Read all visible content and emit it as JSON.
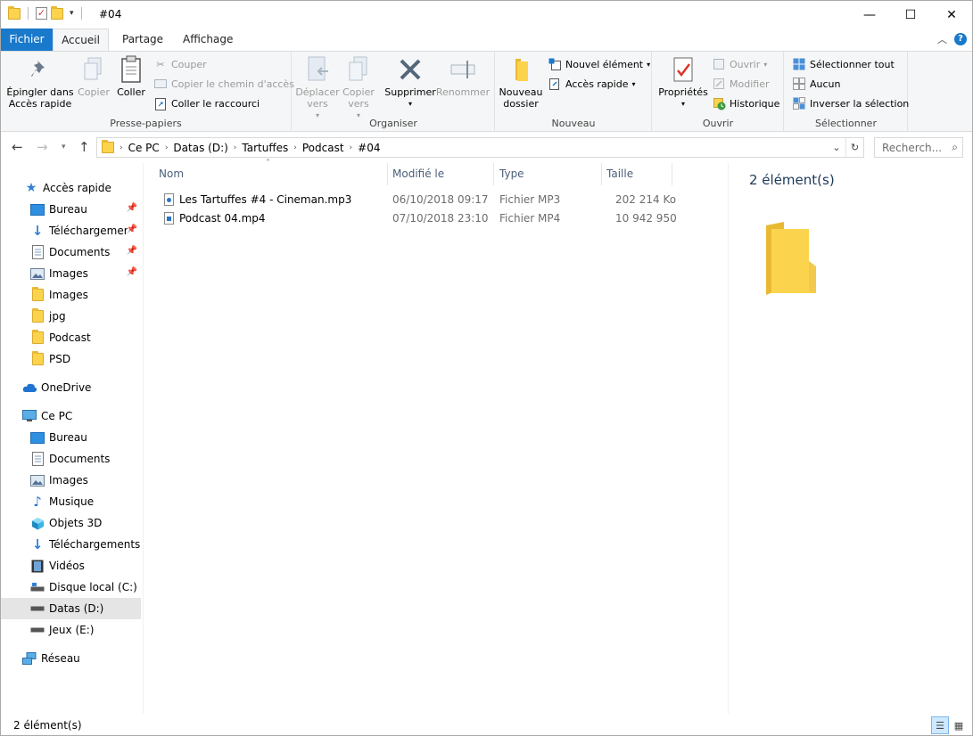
{
  "window": {
    "title": "#04",
    "minimize_glyph": "—",
    "maximize_glyph": "☐",
    "close_glyph": "✕"
  },
  "tabs": {
    "file": "Fichier",
    "home": "Accueil",
    "share": "Partage",
    "view": "Affichage"
  },
  "ribbon": {
    "clipboard": {
      "label": "Presse-papiers",
      "pin": "Épingler dans Accès rapide",
      "copy": "Copier",
      "paste": "Coller",
      "cut": "Couper",
      "copy_path": "Copier le chemin d'accès",
      "paste_shortcut": "Coller le raccourci"
    },
    "organize": {
      "label": "Organiser",
      "move_to": "Déplacer vers",
      "copy_to": "Copier vers",
      "delete": "Supprimer",
      "rename": "Renommer"
    },
    "new": {
      "label": "Nouveau",
      "new_folder": "Nouveau dossier",
      "new_item": "Nouvel élément",
      "easy_access": "Accès rapide"
    },
    "open": {
      "label": "Ouvrir",
      "properties": "Propriétés",
      "open": "Ouvrir",
      "edit": "Modifier",
      "history": "Historique"
    },
    "select": {
      "label": "Sélectionner",
      "select_all": "Sélectionner tout",
      "select_none": "Aucun",
      "invert": "Inverser la sélection"
    }
  },
  "address": {
    "crumbs": [
      "Ce PC",
      "Datas (D:)",
      "Tartuffes",
      "Podcast",
      "#04"
    ],
    "search_placeholder": "Recherch..."
  },
  "nav": {
    "quick_access": "Accès rapide",
    "quick_items": [
      "Bureau",
      "Téléchargements",
      "Documents",
      "Images",
      "Images",
      "jpg",
      "Podcast",
      "PSD"
    ],
    "onedrive": "OneDrive",
    "this_pc": "Ce PC",
    "pc_items": [
      "Bureau",
      "Documents",
      "Images",
      "Musique",
      "Objets 3D",
      "Téléchargements",
      "Vidéos",
      "Disque local (C:)",
      "Datas (D:)",
      "Jeux (E:)"
    ],
    "network": "Réseau"
  },
  "columns": {
    "name": "Nom",
    "modified": "Modifié le",
    "type": "Type",
    "size": "Taille"
  },
  "files": [
    {
      "name": "Les Tartuffes #4 - Cineman.mp3",
      "modified": "06/10/2018 09:17",
      "type": "Fichier MP3",
      "size": "202 214 Ko"
    },
    {
      "name": "Podcast 04.mp4",
      "modified": "07/10/2018 23:10",
      "type": "Fichier MP4",
      "size": "10 942 950"
    }
  ],
  "preview": {
    "count": "2 élément(s)"
  },
  "status": {
    "count": "2 élément(s)"
  },
  "colors": {
    "accent": "#1979ca",
    "folder": "#fcd34d"
  }
}
